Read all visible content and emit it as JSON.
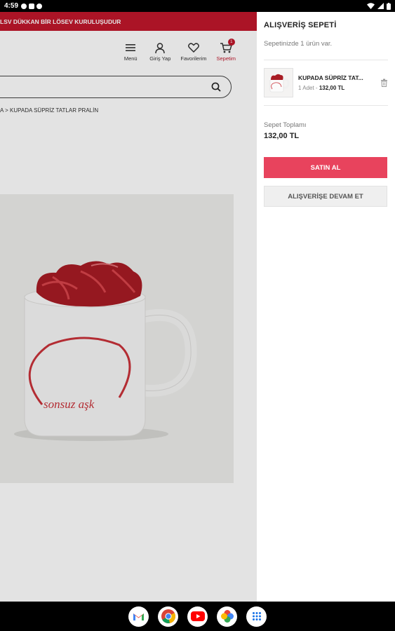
{
  "status_bar": {
    "time": "4:59"
  },
  "promo_text": "LSV DÜKKAN BİR LÖSEV KURULUŞUDUR",
  "nav": [
    {
      "label": "Menü",
      "icon": "menu-icon"
    },
    {
      "label": "Giriş Yap",
      "icon": "user-icon"
    },
    {
      "label": "Favorilerim",
      "icon": "heart-icon"
    },
    {
      "label": "Sepetim",
      "icon": "cart-icon",
      "badge": "1"
    }
  ],
  "breadcrumb": "A > KUPADA SÜPRİZ TATLAR PRALİN",
  "product_image": {
    "cup_text": "sonsuz aşk"
  },
  "cart": {
    "title": "ALIŞVERİŞ SEPETİ",
    "subtitle": "Sepetinizde 1 ürün var.",
    "item": {
      "name": "KUPADA SÜPRİZ TAT...",
      "qty": "1 Adet -",
      "price": "132,00 TL"
    },
    "total_label": "Sepet Toplamı",
    "total_value": "132,00 TL",
    "buy_label": "SATIN AL",
    "continue_label": "ALIŞVERİŞE DEVAM ET"
  },
  "dock_apps": [
    "gmail-icon",
    "chrome-icon",
    "youtube-icon",
    "photos-icon",
    "app-drawer-icon"
  ],
  "colors": {
    "brand_red": "#c0172b",
    "buy_button": "#e8435d"
  }
}
